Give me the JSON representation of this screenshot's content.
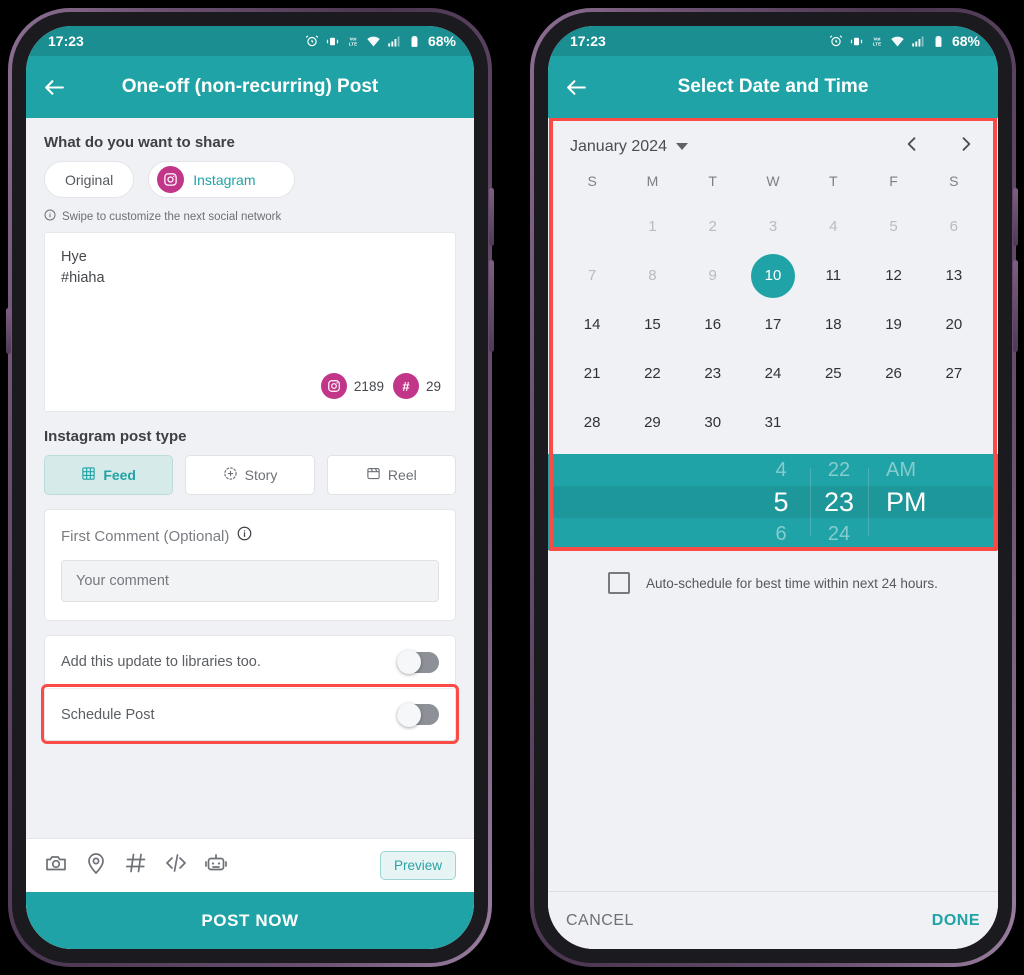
{
  "status_bar": {
    "time": "17:23",
    "battery_percent": "68%",
    "icons": [
      "alarm-icon",
      "vibrate-icon",
      "volte-icon",
      "wifi-icon",
      "signal-icon",
      "battery-icon"
    ]
  },
  "theme": {
    "teal": "#20A3A6",
    "teal_dark": "#1a8e90",
    "magenta": "#C2368A",
    "highlight_red": "#FA4B47",
    "screen_bg": "#eff1f4"
  },
  "left_screen": {
    "appbar": {
      "title": "One-off (non-recurring) Post",
      "back_icon": "back-arrow-icon"
    },
    "share_section": {
      "title": "What do you want to share",
      "tabs": [
        {
          "label": "Original",
          "selected": false,
          "icon": null
        },
        {
          "label": "Instagram",
          "selected": true,
          "icon": "instagram-icon"
        }
      ],
      "hint": "Swipe to customize the next social network",
      "hint_icon": "info-icon"
    },
    "composer": {
      "text": "Hye\n#hiaha",
      "counters": [
        {
          "icon": "instagram-icon",
          "value": "2189"
        },
        {
          "icon": "hashtag-icon",
          "value": "29"
        }
      ]
    },
    "post_type": {
      "title": "Instagram post type",
      "options": [
        {
          "label": "Feed",
          "icon": "grid-icon",
          "selected": true
        },
        {
          "label": "Story",
          "icon": "story-icon",
          "selected": false
        },
        {
          "label": "Reel",
          "icon": "reel-icon",
          "selected": false
        }
      ]
    },
    "first_comment": {
      "label": "First Comment (Optional)",
      "info_icon": "info-icon",
      "placeholder": "Your comment",
      "value": ""
    },
    "toggles": [
      {
        "label": "Add this update to libraries too.",
        "on": false,
        "highlighted": false
      },
      {
        "label": "Schedule Post",
        "on": false,
        "highlighted": true
      }
    ],
    "toolbar": {
      "icons": [
        "camera-icon",
        "location-icon",
        "hashtag-icon",
        "code-icon",
        "robot-icon"
      ],
      "preview_label": "Preview"
    },
    "primary_action": "POST NOW"
  },
  "right_screen": {
    "appbar": {
      "title": "Select Date and Time",
      "back_icon": "back-arrow-icon"
    },
    "calendar": {
      "month_label": "January 2024",
      "dropdown_icon": "chevron-down-icon",
      "prev_icon": "chevron-left-icon",
      "next_icon": "chevron-right-icon",
      "weekday_headers": [
        "S",
        "M",
        "T",
        "W",
        "T",
        "F",
        "S"
      ],
      "selected_day": 10,
      "disabled_days": [
        1,
        2,
        3,
        4,
        5,
        6,
        7,
        8,
        9
      ],
      "weeks": [
        [
          "",
          "1",
          "2",
          "3",
          "4",
          "5",
          "6"
        ],
        [
          "7",
          "8",
          "9",
          "10",
          "11",
          "12",
          "13"
        ],
        [
          "14",
          "15",
          "16",
          "17",
          "18",
          "19",
          "20"
        ],
        [
          "21",
          "22",
          "23",
          "24",
          "25",
          "26",
          "27"
        ],
        [
          "28",
          "29",
          "30",
          "31",
          "",
          "",
          ""
        ]
      ]
    },
    "time_picker": {
      "hours": [
        "4",
        "5",
        "6"
      ],
      "minutes": [
        "22",
        "23",
        "24"
      ],
      "meridiem": [
        "AM",
        "PM",
        ""
      ],
      "selected_hour": "5",
      "selected_minute": "23",
      "selected_meridiem": "PM"
    },
    "auto_schedule": {
      "label": "Auto-schedule for best time within next 24 hours.",
      "checked": false
    },
    "footer": {
      "cancel_label": "CANCEL",
      "done_label": "DONE"
    }
  }
}
